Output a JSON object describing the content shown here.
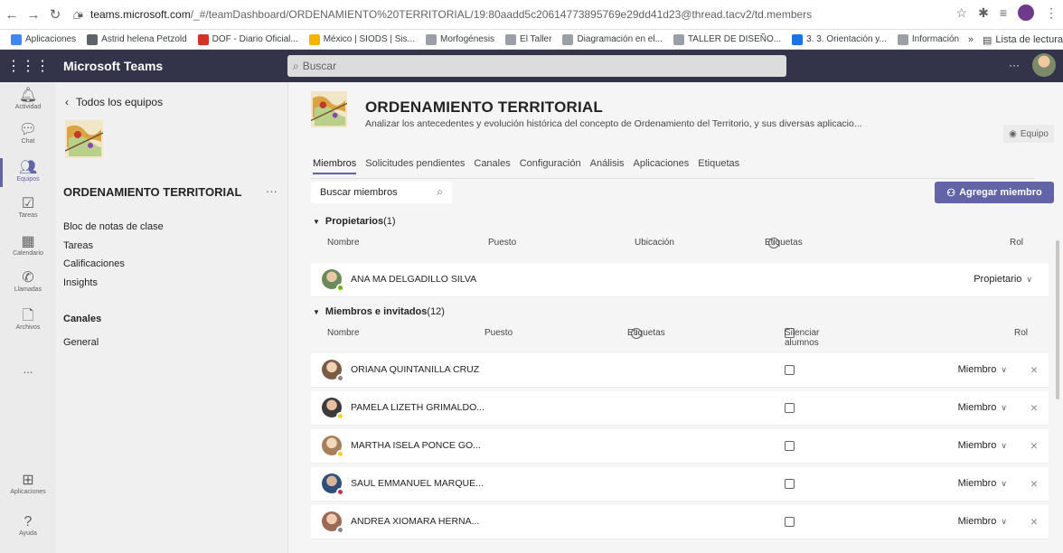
{
  "browser": {
    "url_host": "teams.microsoft.com",
    "url_path": "/_#/teamDashboard/ORDENAMIENTO%20TERRITORIAL/19:80aadd5c20614773895769e29dd41d23@thread.tacv2/td.members",
    "bookmarks": [
      {
        "label": "Aplicaciones",
        "icon": "apps-grid-icon",
        "color": "#4285f4"
      },
      {
        "label": "Astrid helena Petzold",
        "icon": "globe-icon",
        "color": "#5f6368"
      },
      {
        "label": "DOF - Diario Oficial...",
        "icon": "dof-icon",
        "color": "#d93025"
      },
      {
        "label": "México | SIODS | Sis...",
        "icon": "siods-icon",
        "color": "#f4b400"
      },
      {
        "label": "Morfogénesis",
        "icon": "tn-icon",
        "color": "#9aa0a6"
      },
      {
        "label": "El Taller",
        "icon": "tn-icon",
        "color": "#9aa0a6"
      },
      {
        "label": "Diagramación en el...",
        "icon": "tn-icon",
        "color": "#9aa0a6"
      },
      {
        "label": "TALLER DE DISEÑO...",
        "icon": "tn-icon",
        "color": "#9aa0a6"
      },
      {
        "label": "3. 3. Orientación y...",
        "icon": "edge-icon",
        "color": "#1a73e8"
      },
      {
        "label": "Información PMOT...",
        "icon": "site-icon",
        "color": "#9aa0a6"
      }
    ],
    "bookmarks_more": "»",
    "reading_list": "Lista de lectura"
  },
  "teams": {
    "app_name": "Microsoft Teams",
    "search_placeholder": "Buscar",
    "more": "···"
  },
  "rail": [
    {
      "label": "Actividad",
      "icon": "bell-icon",
      "glyph": "🔔︎"
    },
    {
      "label": "Chat",
      "icon": "chat-icon",
      "glyph": "💬︎"
    },
    {
      "label": "Equipos",
      "icon": "teams-icon",
      "glyph": "👥︎"
    },
    {
      "label": "Tareas",
      "icon": "tasks-icon",
      "glyph": "☑"
    },
    {
      "label": "Calendario",
      "icon": "calendar-icon",
      "glyph": "▦"
    },
    {
      "label": "Llamadas",
      "icon": "phone-icon",
      "glyph": "✆"
    },
    {
      "label": "Archivos",
      "icon": "file-icon",
      "glyph": "🗋"
    },
    {
      "label": "...",
      "icon": "more-icon",
      "glyph": ""
    },
    {
      "label": "Aplicaciones",
      "icon": "apps-icon",
      "glyph": "⊞"
    },
    {
      "label": "Ayuda",
      "icon": "help-icon",
      "glyph": "?"
    }
  ],
  "panel": {
    "back": "Todos los equipos",
    "team_name": "ORDENAMIENTO TERRITORIAL",
    "team_more": "···",
    "items": [
      "Bloc de notas de clase",
      "Tareas",
      "Calificaciones",
      "Insights"
    ],
    "channels_header": "Canales",
    "channels": [
      "General"
    ]
  },
  "header": {
    "title": "ORDENAMIENTO TERRITORIAL",
    "dots": "···",
    "description": "Analizar los antecedentes y evolución histórica del concepto de Ordenamiento del Territorio, y sus diversas aplicacio...",
    "badge": "Equipo"
  },
  "tabs": [
    "Miembros",
    "Solicitudes pendientes",
    "Canales",
    "Configuración",
    "Análisis",
    "Aplicaciones",
    "Etiquetas"
  ],
  "member_search_placeholder": "Buscar miembros",
  "add_member": "Agregar miembro",
  "owners": {
    "title": "Propietarios",
    "count": "(1)",
    "columns": {
      "name": "Nombre",
      "position": "Puesto",
      "location": "Ubicación",
      "tags": "Etiquetas",
      "role": "Rol"
    },
    "rows": [
      {
        "name": "ANA MA DELGADILLO SILVA",
        "role": "Propietario",
        "presence": "#6bb700"
      }
    ]
  },
  "members": {
    "title": "Miembros e invitados",
    "count": "(12)",
    "columns": {
      "name": "Nombre",
      "position": "Puesto",
      "tags": "Etiquetas",
      "mute": "Silenciar alumnos",
      "role": "Rol"
    },
    "rows": [
      {
        "name": "ORIANA QUINTANILLA CRUZ",
        "role": "Miembro",
        "presence": "#8a8886"
      },
      {
        "name": "PAMELA LIZETH GRIMALDO...",
        "role": "Miembro",
        "presence": "#f8d22a"
      },
      {
        "name": "MARTHA ISELA PONCE GO...",
        "role": "Miembro",
        "presence": "#f8d22a"
      },
      {
        "name": "SAUL EMMANUEL MARQUE...",
        "role": "Miembro",
        "presence": "#c4314b"
      },
      {
        "name": "ANDREA XIOMARA HERNA...",
        "role": "Miembro",
        "presence": "#8a8886"
      }
    ]
  },
  "colors": {
    "accent": "#6264a7",
    "topbar": "#33344a"
  }
}
